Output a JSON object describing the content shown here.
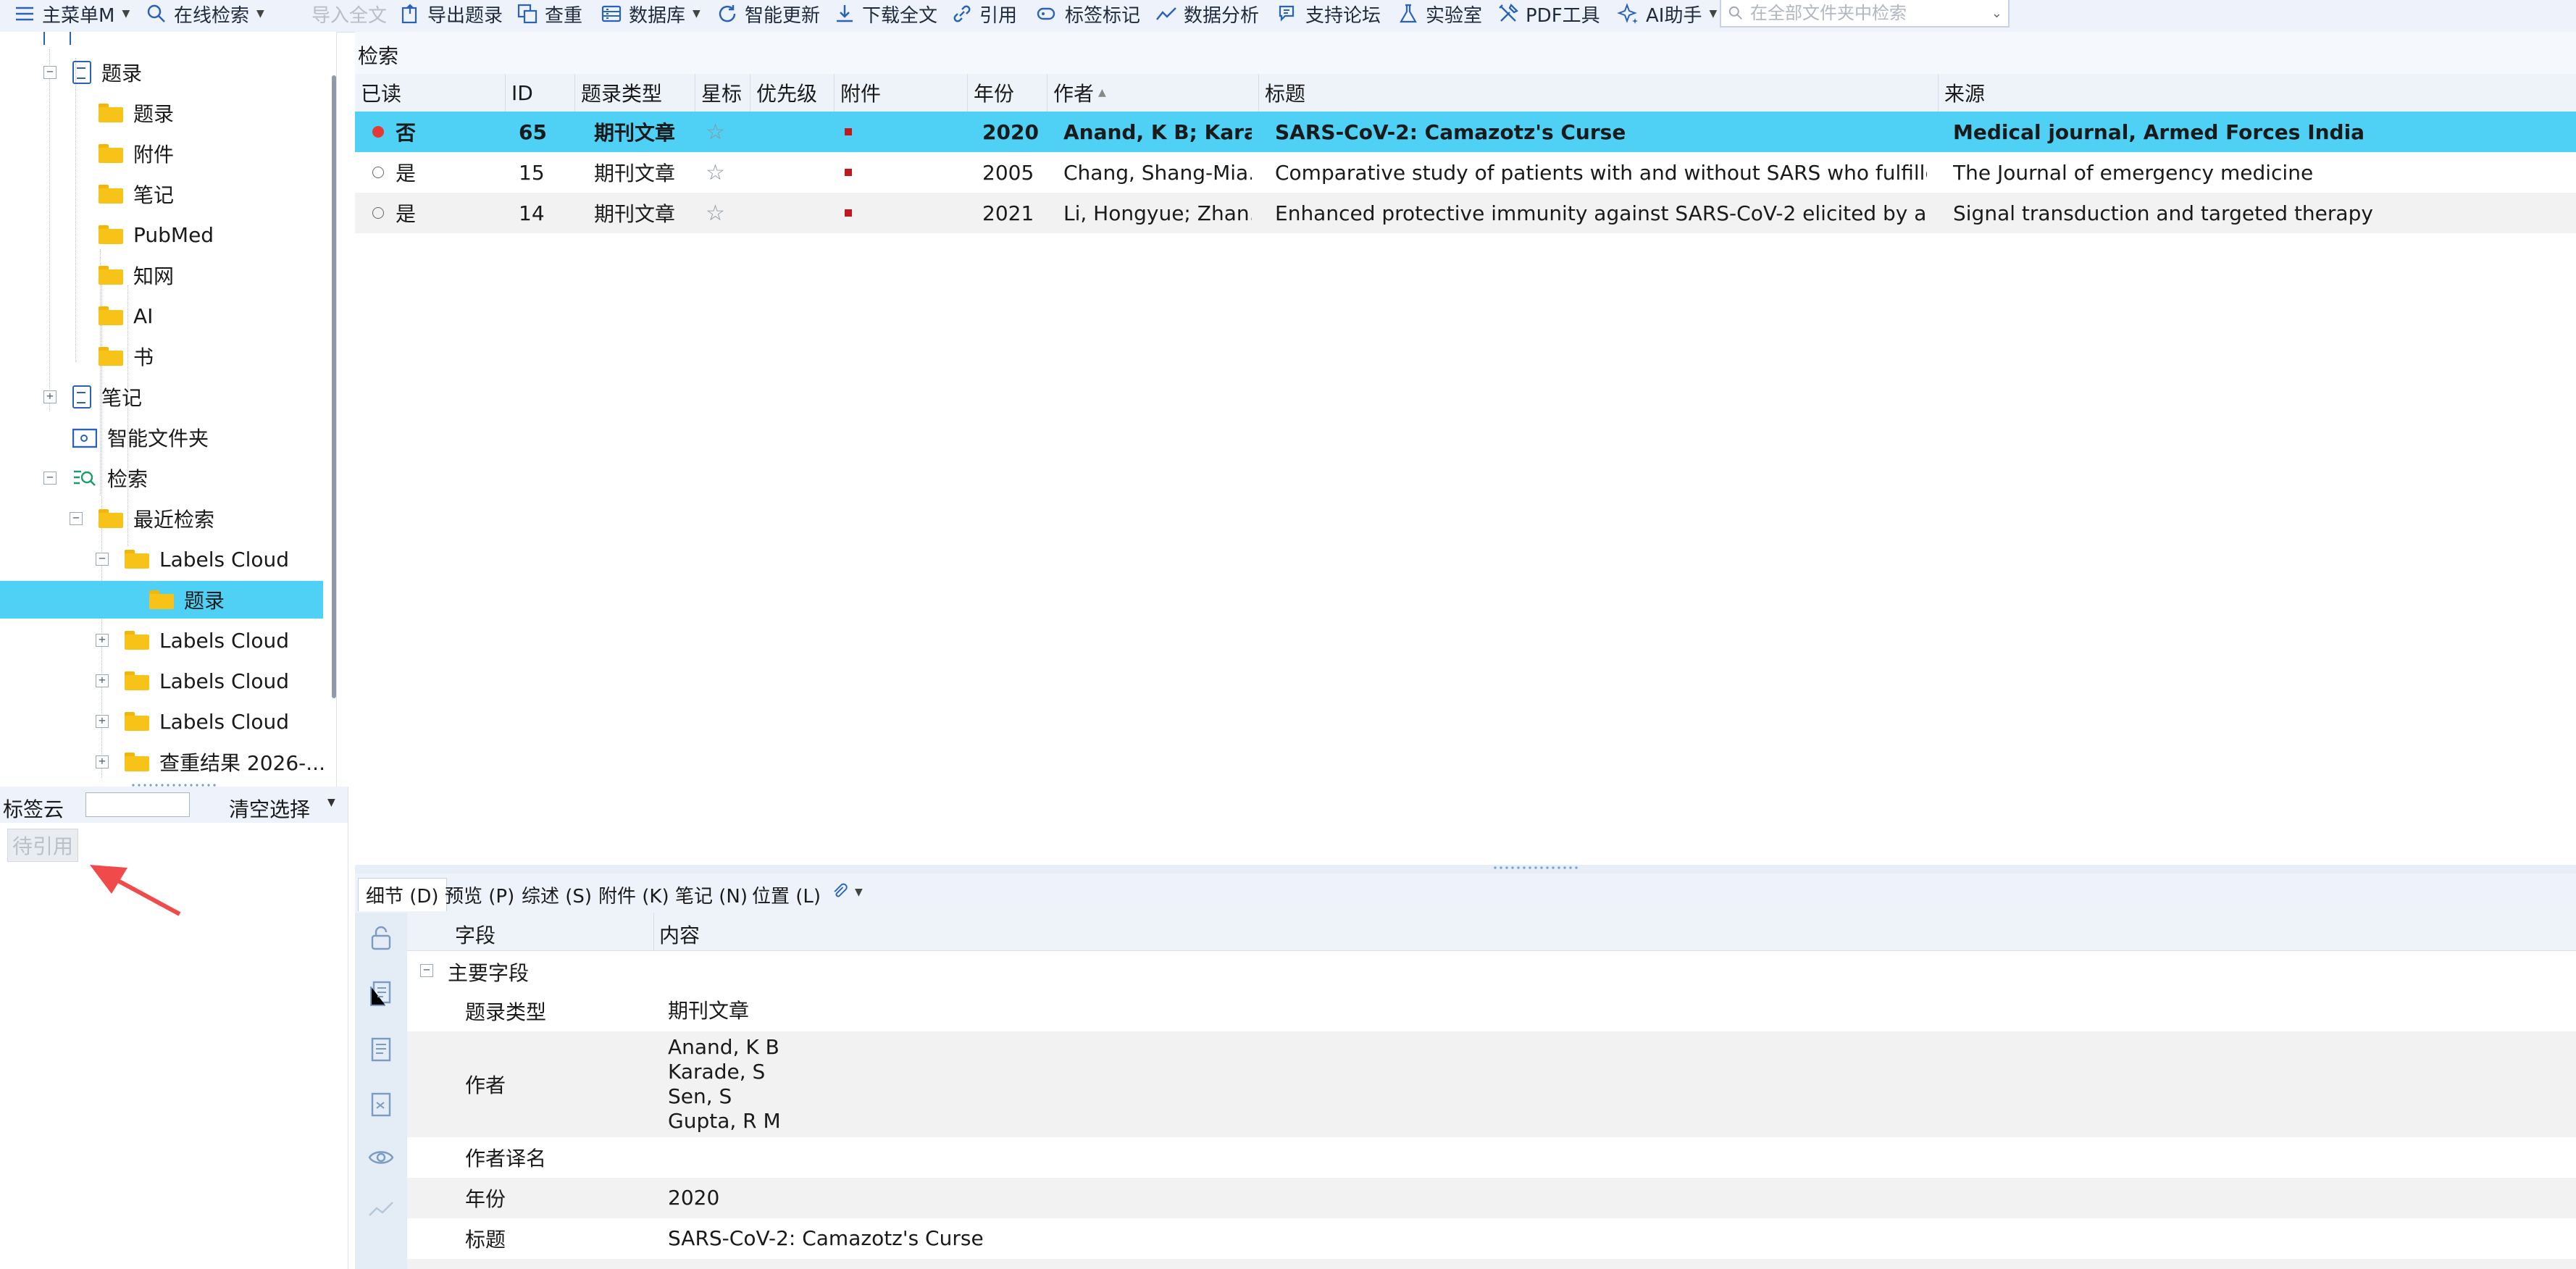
{
  "toolbar": {
    "items": [
      {
        "label": "主菜单M",
        "icon": "hamburger-menu-icon",
        "caret": true
      },
      {
        "label": "在线检索",
        "icon": "search-icon",
        "caret": true
      },
      {
        "label": "导入全文",
        "disabled": true
      },
      {
        "label": "导出题录",
        "icon": "export-icon"
      },
      {
        "label": "查重",
        "icon": "duplicate-icon"
      },
      {
        "label": "数据库",
        "icon": "database-icon",
        "caret": true
      },
      {
        "label": "智能更新",
        "icon": "refresh-icon"
      },
      {
        "label": "下载全文",
        "icon": "download-icon"
      },
      {
        "label": "引用",
        "icon": "link-icon"
      },
      {
        "label": "标签标记",
        "icon": "tag-icon"
      },
      {
        "label": "数据分析",
        "icon": "chart-icon"
      },
      {
        "label": "支持论坛",
        "icon": "forum-icon"
      },
      {
        "label": "实验室",
        "icon": "flask-icon"
      },
      {
        "label": "PDF工具",
        "icon": "tools-icon"
      },
      {
        "label": "AI助手",
        "icon": "ai-sparkle-icon",
        "caret": true
      }
    ],
    "search_placeholder": "在全部文件夹中检索"
  },
  "tree": {
    "items": [
      {
        "label": "题录",
        "icon": "document-icon"
      },
      {
        "label": "题录",
        "icon": "folder-icon"
      },
      {
        "label": "附件",
        "icon": "folder-icon"
      },
      {
        "label": "笔记",
        "icon": "folder-icon"
      },
      {
        "label": "PubMed",
        "icon": "folder-icon"
      },
      {
        "label": "知网",
        "icon": "folder-icon"
      },
      {
        "label": "AI",
        "icon": "folder-icon"
      },
      {
        "label": "书",
        "icon": "folder-icon"
      },
      {
        "label": "笔记",
        "icon": "note-icon"
      },
      {
        "label": "智能文件夹",
        "icon": "smart-folder-icon"
      },
      {
        "label": "检索",
        "icon": "search-list-icon"
      },
      {
        "label": "最近检索",
        "icon": "folder-open-icon"
      },
      {
        "label": "Labels Cloud",
        "icon": "folder-open-icon"
      },
      {
        "label": "题录",
        "icon": "folder-icon"
      },
      {
        "label": "Labels Cloud",
        "icon": "folder-icon"
      },
      {
        "label": "Labels Cloud",
        "icon": "folder-icon"
      },
      {
        "label": "Labels Cloud",
        "icon": "folder-icon"
      },
      {
        "label": "查重结果 2026-...",
        "icon": "folder-icon"
      }
    ]
  },
  "labels": {
    "title": "标签云",
    "clear_label": "清空选择",
    "tag": "待引用"
  },
  "list": {
    "breadcrumb": "检索",
    "columns": [
      "已读",
      "ID",
      "题录类型",
      "星标",
      "优先级",
      "附件",
      "年份",
      "作者",
      "标题",
      "来源"
    ],
    "sort_indicator": "▲",
    "rows": [
      {
        "read": "否",
        "id": "65",
        "type": "期刊文章",
        "year": "2020",
        "authors": "Anand, K B; Karad...",
        "title": "SARS-CoV-2: Camazotz's Curse",
        "source": "Medical journal, Armed Forces India"
      },
      {
        "read": "是",
        "id": "15",
        "type": "期刊文章",
        "year": "2005",
        "authors": "Chang, Shang-Mia...",
        "title": "Comparative study of patients with and without SARS who fulfilled t...",
        "source": "The Journal of emergency medicine"
      },
      {
        "read": "是",
        "id": "14",
        "type": "期刊文章",
        "year": "2021",
        "authors": "Li, Hongyue; Zhan...",
        "title": "Enhanced protective immunity against SARS-CoV-2 elicited by a VS...",
        "source": "Signal transduction and targeted therapy"
      }
    ]
  },
  "detail": {
    "tabs": [
      "细节 (D)",
      "预览 (P)",
      "综述 (S)",
      "附件 (K)",
      "笔记 (N)",
      "位置 (L)"
    ],
    "header": {
      "field": "字段",
      "content": "内容"
    },
    "group_label": "主要字段",
    "fields": [
      {
        "field": "题录类型",
        "value": [
          "期刊文章"
        ]
      },
      {
        "field": "作者",
        "value": [
          "Anand, K B",
          "Karade, S",
          "Sen, S",
          "Gupta, R M"
        ]
      },
      {
        "field": "作者译名",
        "value": [
          ""
        ]
      },
      {
        "field": "年份",
        "value": [
          "2020"
        ]
      },
      {
        "field": "标题",
        "value": [
          "SARS-CoV-2: Camazotz's Curse"
        ]
      }
    ]
  },
  "colors": {
    "selection": "#4fd0f5",
    "toolbar_bg": "#eef3fb",
    "unread_dot": "#e53935",
    "annotation_arrow": "#f04a4a"
  }
}
